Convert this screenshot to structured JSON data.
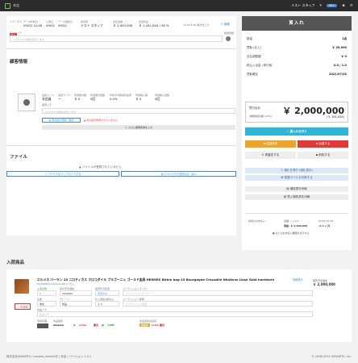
{
  "topbar": {
    "app_title": "本店",
    "user": "テスト スタッフ",
    "badge": "99+"
  },
  "header": {
    "status_label": "ステータス",
    "status_value": "入荷済",
    "status_tag": "仕入",
    "date_label": "データ作成日",
    "date_value": "09/02 12:46",
    "arrival_label": "入荷日",
    "arrival_value": "09/02",
    "updated_label": "データ更新日",
    "updated_value": "09/02",
    "staff_label": "担当者",
    "staff_value": "テスト スタッフ",
    "amount_label": "査定金額",
    "amount_value": "￥ 2,000,000",
    "rate_label": "査定利益",
    "rate_value": "￥ 1,181,818 / 38 %",
    "created_note": "12-03 4:00 開きました",
    "edit_label": "編集",
    "memo_label": "データメモ",
    "memo_placeholder": "入力された内容を表示します",
    "register_label": "担当登録"
  },
  "customer": {
    "title": "顧客情報",
    "fields": [
      {
        "label": "会員コード",
        "value": "非会員"
      },
      {
        "label": "会員ランク",
        "value": "ー"
      },
      {
        "label": "年間累計額",
        "value": "￥ 0"
      },
      {
        "label": "年間累計回数",
        "value": "0回"
      },
      {
        "label": "年間平均購買利益率",
        "value": "0.0%"
      },
      {
        "label": "年間購入額",
        "value": "￥ 0"
      },
      {
        "label": "年間購入回数",
        "value": "0回"
      }
    ],
    "memo_label": "顧客メモ",
    "memo_placeholder": "入力された内容を表示します",
    "id_button": "身分証の登録・確認",
    "warning": "身分証が登録されていません",
    "more_button": "さらに顧客情報を入力"
  },
  "files": {
    "title": "ファイル",
    "empty_note": "ファイルが登録されていません",
    "upload_button": "ファイルをアップロードする",
    "scan_button": "スキャナから読み込む (A4)"
  },
  "summary": {
    "title": "買入れ",
    "rows": [
      {
        "label": "数量",
        "value": "1点"
      },
      {
        "label": "買取 (仕入)",
        "value": "￥ 20,000"
      },
      {
        "label": "支払調整額",
        "value": "￥ 0"
      },
      {
        "label": "税込入出金 / 税引後",
        "value": "0.0 / 1.0"
      },
      {
        "label": "買取確定",
        "value": "2021/07/02"
      }
    ],
    "total_label": "買付合計",
    "total_value": "￥ 2,000,000",
    "tax_label": "消費税相当額 (10%)",
    "tax_value": "(￥ 181,818)",
    "buy_button": "買入れを行う",
    "hold_button": "保留条件",
    "exit_button": "出退する",
    "check_button": "再査定する",
    "delete_button": "削除する",
    "print_button": "値札を発行 (値札表示)",
    "label_button": "振替ラベルを印刷する",
    "receipt_button": "領収書を印刷",
    "agreement_button": "買入契約書を印刷",
    "pay_rows": [
      {
        "label": "前回のお支払い",
        "left": "店舗: レジA-1",
        "right": "09/02 12:46"
      },
      {
        "label": "",
        "left": "現金: ￥ 2,000,000",
        "right": "-2.4 × 円"
      }
    ],
    "all_payments": "全てのお支払い履歴を表示する"
  },
  "product": {
    "section_title": "入荷商品",
    "name": "エルメス バーキン 25 ニロティカス クロコダイル ブルゴーニュ ゴールド金具 HERMES Birkin bag 25 Bourgogne Crocodile Niloticus Lisse Gold hardware",
    "code": "EG36686C11424-01-B01 / 仕入",
    "edit_link": "詳細表示",
    "price_label": "販売予定価格",
    "price_value": "￥ 2,000,000",
    "qty_label": "入荷点数",
    "qty_value": "1",
    "buy_label": "買付予定価格",
    "buy_value": "2000000",
    "cond_label": "販売状況変更",
    "cond_value": "査定済み",
    "condnote_label": "コンディションランク",
    "condnote_placeholder": "コンディションランク",
    "stock_label": "在庫",
    "stock_value": "非在",
    "grade_label": "グレード",
    "grade_value": "新品",
    "base_label": "仕入価格(送料込)",
    "base_value": "￥ 0",
    "condmemo_label": "コンディション詳細",
    "condmemo_placeholder": "コンディション詳細",
    "item_memo_label": "商品メモ",
    "item_memo_placeholder": "商品メモ",
    "release_label": "不良時",
    "store_label": "登録店舗",
    "mall_label": "商品連携",
    "mall_label2": "商品連携先指定",
    "malls": [
      "amazon",
      "ecfan",
      "楽天",
      "LINE",
      "ecfan",
      "楽天"
    ]
  },
  "footer": {
    "left": "株式会社NAVARTS / novarts_demo2@ | 本店 | バージョン 2.0.1",
    "right": "© 2008-2021 NOVARTS, Inc."
  },
  "colors": {
    "accent": "#3d8be0",
    "teal": "#2bb5d8",
    "red": "#e53935",
    "orange": "#f0a424",
    "dark": "#555555"
  }
}
